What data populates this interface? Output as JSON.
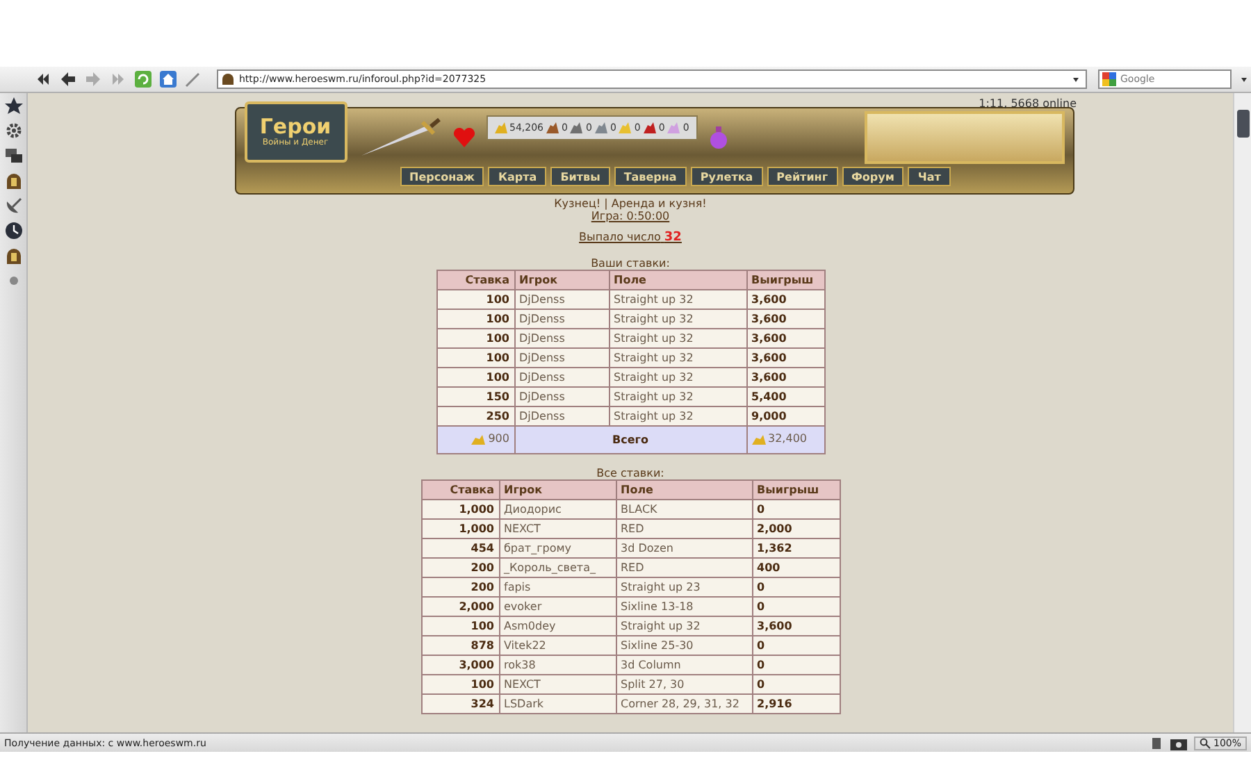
{
  "toolbar": {
    "address": "http://www.heroeswm.ru/inforoul.php?id=2077325",
    "search": {
      "placeholder": "Google"
    }
  },
  "banner": {
    "logo_title": "Герои",
    "logo_subtitle": "Войны и Денег",
    "resources": [
      "54,206",
      "0",
      "0",
      "0",
      "0",
      "0",
      "0"
    ],
    "nav": [
      "Персонаж",
      "Карта",
      "Битвы",
      "Таверна",
      "Рулетка",
      "Рейтинг",
      "Форум",
      "Чат"
    ]
  },
  "online": "1:11, 5668 online",
  "notice": "Кузнец! | Аренда и кузня!",
  "game_time": "Игра: 0:50:00",
  "result": {
    "label": "Выпало число",
    "number": "32"
  },
  "your_bets": {
    "title": "Ваши ставки:",
    "columns": [
      "Ставка",
      "Игрок",
      "Поле",
      "Выигрыш"
    ],
    "rows": [
      [
        "100",
        "DjDenss",
        "Straight up 32",
        "3,600"
      ],
      [
        "100",
        "DjDenss",
        "Straight up 32",
        "3,600"
      ],
      [
        "100",
        "DjDenss",
        "Straight up 32",
        "3,600"
      ],
      [
        "100",
        "DjDenss",
        "Straight up 32",
        "3,600"
      ],
      [
        "100",
        "DjDenss",
        "Straight up 32",
        "3,600"
      ],
      [
        "150",
        "DjDenss",
        "Straight up 32",
        "5,400"
      ],
      [
        "250",
        "DjDenss",
        "Straight up 32",
        "9,000"
      ]
    ],
    "total": {
      "stake": "900",
      "label": "Всего",
      "win": "32,400"
    }
  },
  "all_bets": {
    "title": "Все ставки:",
    "columns": [
      "Ставка",
      "Игрок",
      "Поле",
      "Выигрыш"
    ],
    "rows": [
      [
        "1,000",
        "Диодорис",
        "BLACK",
        "0"
      ],
      [
        "1,000",
        "NEXCT",
        "RED",
        "2,000"
      ],
      [
        "454",
        "брат_грому",
        "3d Dozen",
        "1,362"
      ],
      [
        "200",
        "_Король_света_",
        "RED",
        "400"
      ],
      [
        "200",
        "fapis",
        "Straight up 23",
        "0"
      ],
      [
        "2,000",
        "evoker",
        "Sixline 13-18",
        "0"
      ],
      [
        "100",
        "Asm0dey",
        "Straight up 32",
        "3,600"
      ],
      [
        "878",
        "Vitek22",
        "Sixline 25-30",
        "0"
      ],
      [
        "3,000",
        "rok38",
        "3d Column",
        "0"
      ],
      [
        "100",
        "NEXCT",
        "Split 27, 30",
        "0"
      ],
      [
        "324",
        "LSDark",
        "Corner 28, 29, 31, 32",
        "2,916"
      ]
    ]
  },
  "status_bar": {
    "text": "Получение данных: с www.heroeswm.ru",
    "zoom": "100%"
  }
}
